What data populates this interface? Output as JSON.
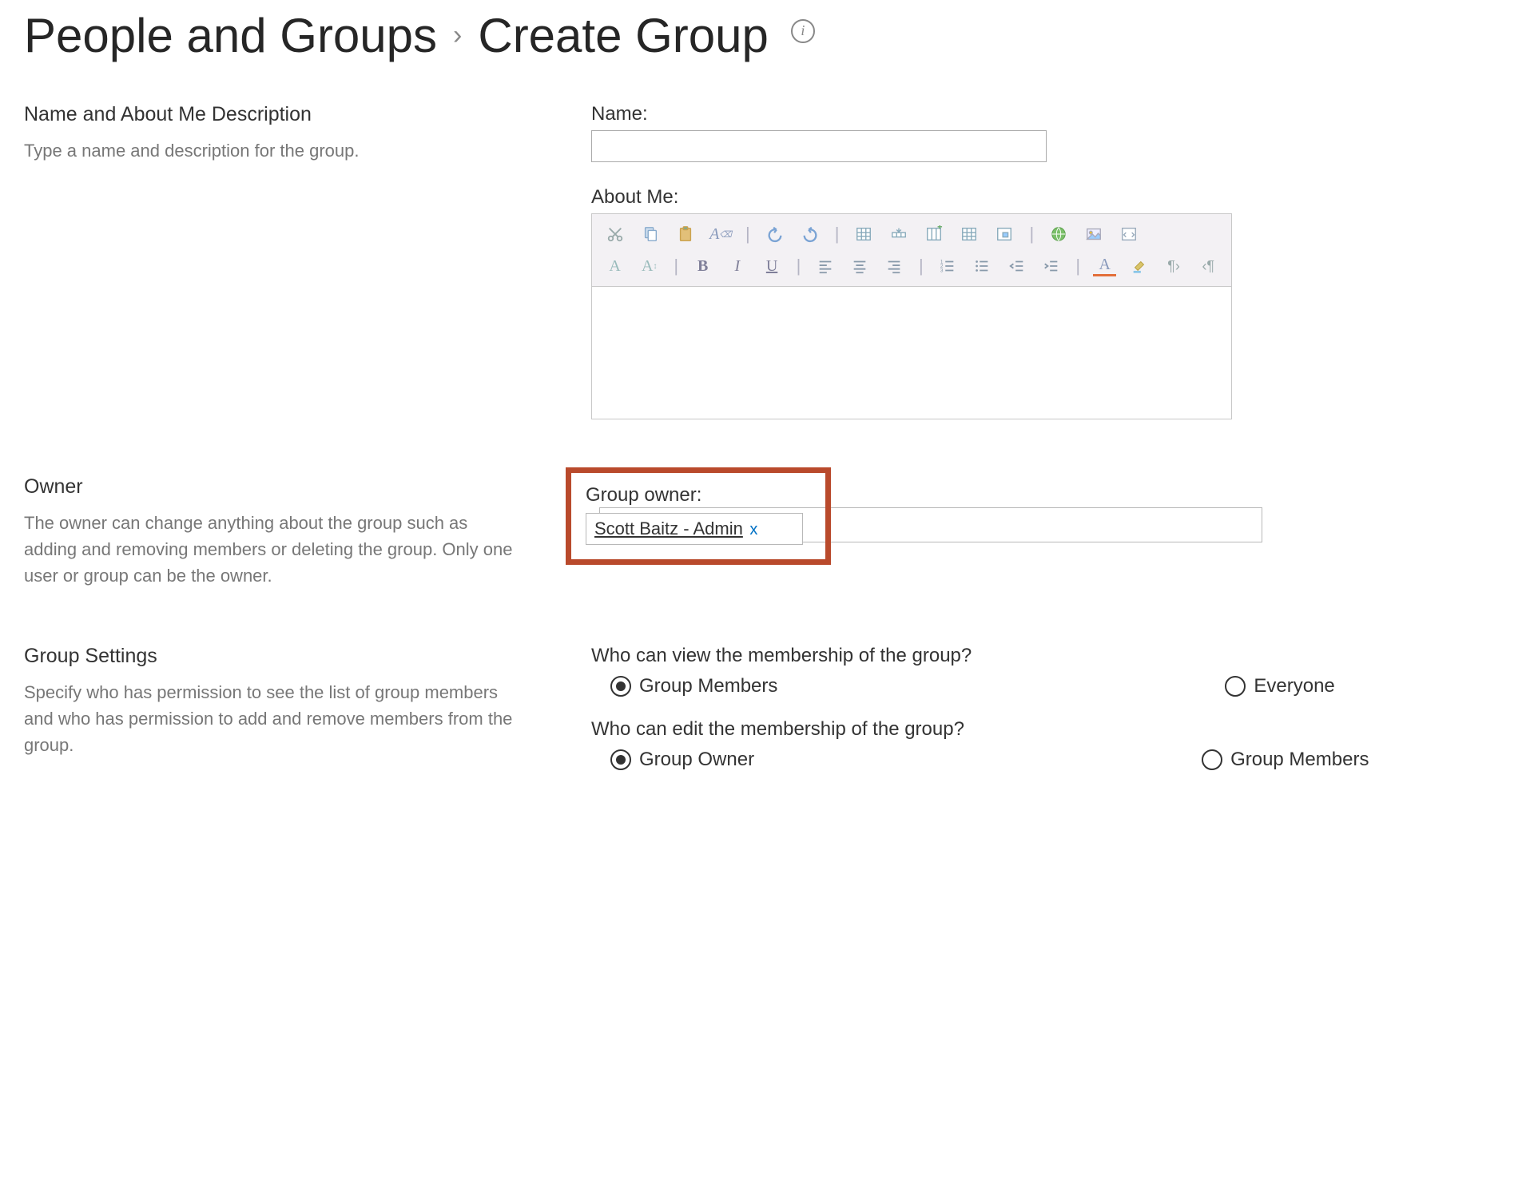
{
  "title": {
    "part1": "People and Groups",
    "separator": "›",
    "part2": "Create Group",
    "info_icon_label": "i"
  },
  "sections": {
    "name": {
      "heading": "Name and About Me Description",
      "description": "Type a name and description for the group.",
      "name_label": "Name:",
      "name_value": "",
      "about_label": "About Me:"
    },
    "owner": {
      "heading": "Owner",
      "description": "The owner can change anything about the group such as adding and removing members or deleting the group. Only one user or group can be the owner.",
      "field_label": "Group owner:",
      "owner_chip": "Scott Baitz - Admin",
      "remove_glyph": "x"
    },
    "settings": {
      "heading": "Group Settings",
      "description": "Specify who has permission to see the list of group members and who has permission to add and remove members from the group.",
      "view_question": "Who can view the membership of the group?",
      "view_options": {
        "a": "Group Members",
        "b": "Everyone"
      },
      "view_selected": "a",
      "edit_question": "Who can edit the membership of the group?",
      "edit_options": {
        "a": "Group Owner",
        "b": "Group Members"
      },
      "edit_selected": "a"
    }
  },
  "rte_icons": {
    "cut": "cut",
    "copy": "copy",
    "paste": "paste",
    "clearfmt": "clear-format",
    "undo": "undo",
    "redo": "redo",
    "inserttable": "insert-table",
    "rowabove": "insert-row",
    "colright": "insert-col",
    "table2": "table-grid",
    "cell": "edit-cell",
    "link": "hyperlink",
    "image": "image",
    "html": "html-source",
    "fontcolor": "A",
    "fontsize": "A↕",
    "bold": "B",
    "italic": "I",
    "underline": "U",
    "alignl": "align-left",
    "alignc": "align-center",
    "alignr": "align-right",
    "numlist": "ol",
    "bullist": "ul",
    "outdent": "outdent",
    "indent": "indent",
    "hilite": "A",
    "bgcolor": "bg",
    "ltr": "¶›",
    "rtl": "‹¶"
  }
}
